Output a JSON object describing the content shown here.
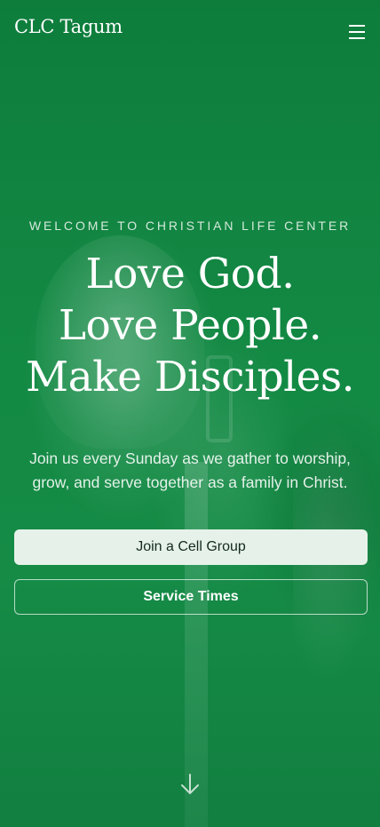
{
  "header": {
    "logo_text": "CLC Tagum",
    "menu_icon": "hamburger-menu-icon"
  },
  "hero": {
    "eyebrow": "WELCOME TO CHRISTIAN LIFE CENTER",
    "headline_lines": [
      "Love God.",
      "Love People.",
      "Make Disciples."
    ],
    "intro": "Join us every Sunday as we gather to worship, grow, and serve together as a family in Christ.",
    "primary_button": "Join a Cell Group",
    "secondary_button": "Service Times",
    "scroll_icon": "arrow-down-icon"
  },
  "colors": {
    "background": "#138a44",
    "primary_button_bg": "#e6f2e9",
    "primary_button_text": "#142a1c",
    "text": "#ffffff"
  }
}
